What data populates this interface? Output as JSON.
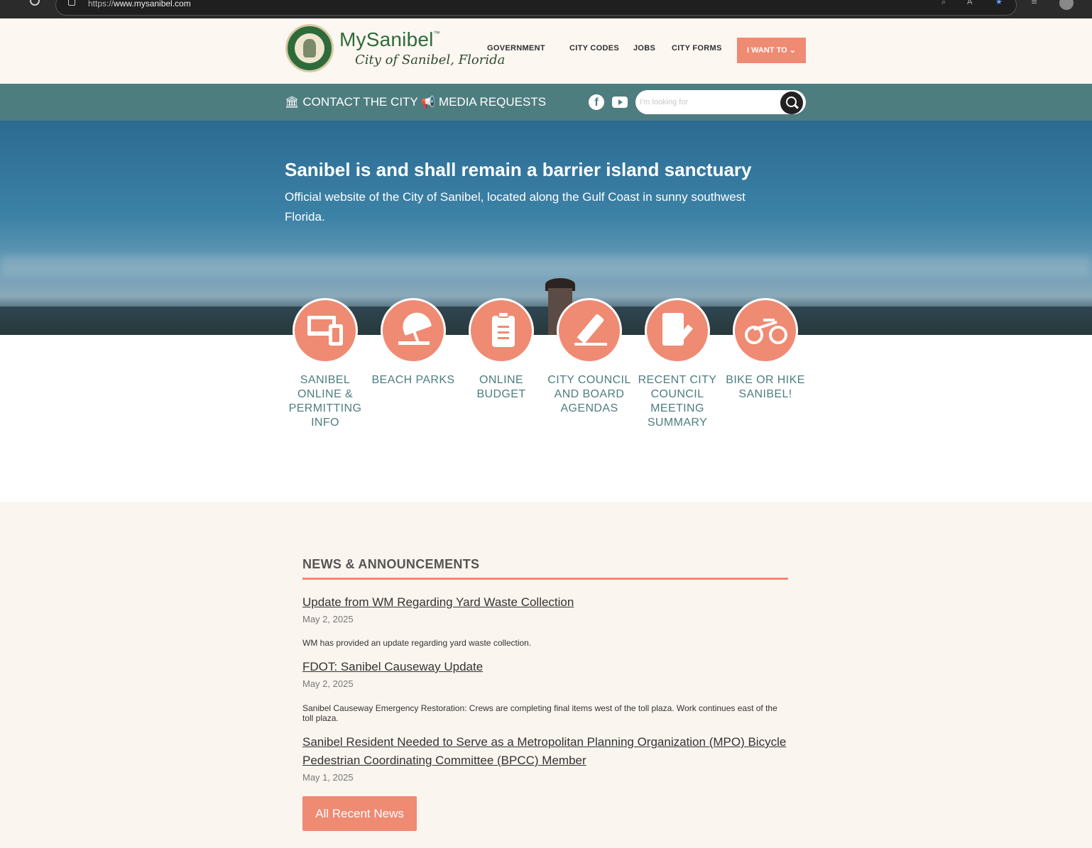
{
  "browser": {
    "url_prefix": "https://",
    "url_host": "www.mysanibel.com"
  },
  "header": {
    "brand_name": "MySanibel",
    "brand_tm": "™",
    "brand_subtitle": "City of Sanibel, Florida",
    "nav": [
      "GOVERNMENT",
      "CITY CODES",
      "JOBS",
      "CITY FORMS"
    ],
    "i_want_to": "I WANT TO ⌄",
    "brand_color": "#2f6b3a",
    "accent_color": "#ef8a73"
  },
  "utility_bar": {
    "contact": "CONTACT THE CITY",
    "media": "MEDIA REQUESTS",
    "search_placeholder": "I'm looking for",
    "bar_color": "#4e7d80"
  },
  "hero": {
    "title": "Sanibel is and shall remain a barrier island sanctuary",
    "subtitle": "Official website of the City of Sanibel, located along the Gulf Coast in sunny southwest Florida."
  },
  "quick_links": [
    {
      "label": "SANIBEL ONLINE & PERMITTING INFO",
      "icon": "devices-icon"
    },
    {
      "label": "BEACH PARKS",
      "icon": "beach-umbrella-icon"
    },
    {
      "label": "ONLINE BUDGET",
      "icon": "clipboard-list-icon"
    },
    {
      "label": "CITY COUNCIL AND BOARD AGENDAS",
      "icon": "pencil-icon"
    },
    {
      "label": "RECENT CITY COUNCIL MEETING SUMMARY",
      "icon": "document-edit-icon"
    },
    {
      "label": "BIKE OR HIKE SANIBEL!",
      "icon": "bicycle-icon"
    }
  ],
  "news": {
    "heading": "NEWS & ANNOUNCEMENTS",
    "items": [
      {
        "title": "Update from WM Regarding Yard Waste Collection",
        "date": "May 2, 2025",
        "desc": "WM has provided an update regarding yard waste collection."
      },
      {
        "title": "FDOT: Sanibel Causeway Update",
        "date": "May 2, 2025",
        "desc": "Sanibel Causeway Emergency Restoration: Crews are completing final items west of the toll plaza. Work continues east of the toll plaza."
      },
      {
        "title": "Sanibel Resident Needed to Serve as a Metropolitan Planning Organization (MPO) Bicycle Pedestrian Coordinating Committee (BPCC) Member",
        "date": "May 1, 2025"
      }
    ],
    "all_button": "All Recent News"
  }
}
